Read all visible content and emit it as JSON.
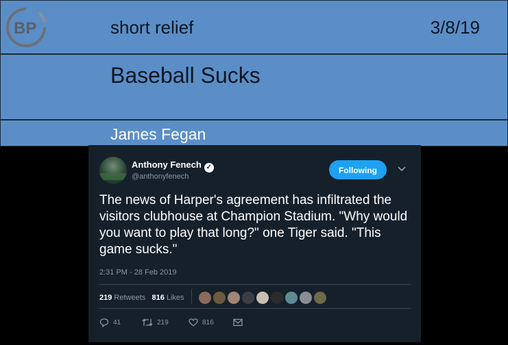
{
  "header": {
    "logo_text": "BP",
    "section": "short relief",
    "date": "3/8/19",
    "title": "Baseball Sucks",
    "author": "James Fegan"
  },
  "tweet": {
    "name": "Anthony Fenech",
    "handle": "@anthonyfenech",
    "follow_label": "Following",
    "body": "The news of Harper's agreement has infiltrated the visitors clubhouse at Champion Stadium. \"Why would you want to play that long?\" one Tiger said. \"This game sucks.\"",
    "timestamp": "2:31 PM - 28 Feb 2019",
    "retweets_count": "219",
    "retweets_label": "Retweets",
    "likes_count": "816",
    "likes_label": "Likes",
    "reply_count": "41",
    "retweet_action_count": "219",
    "like_action_count": "816"
  },
  "colors": {
    "band": "#5b8ec7",
    "tweet_bg": "#15202b",
    "follow": "#1da1f2"
  }
}
